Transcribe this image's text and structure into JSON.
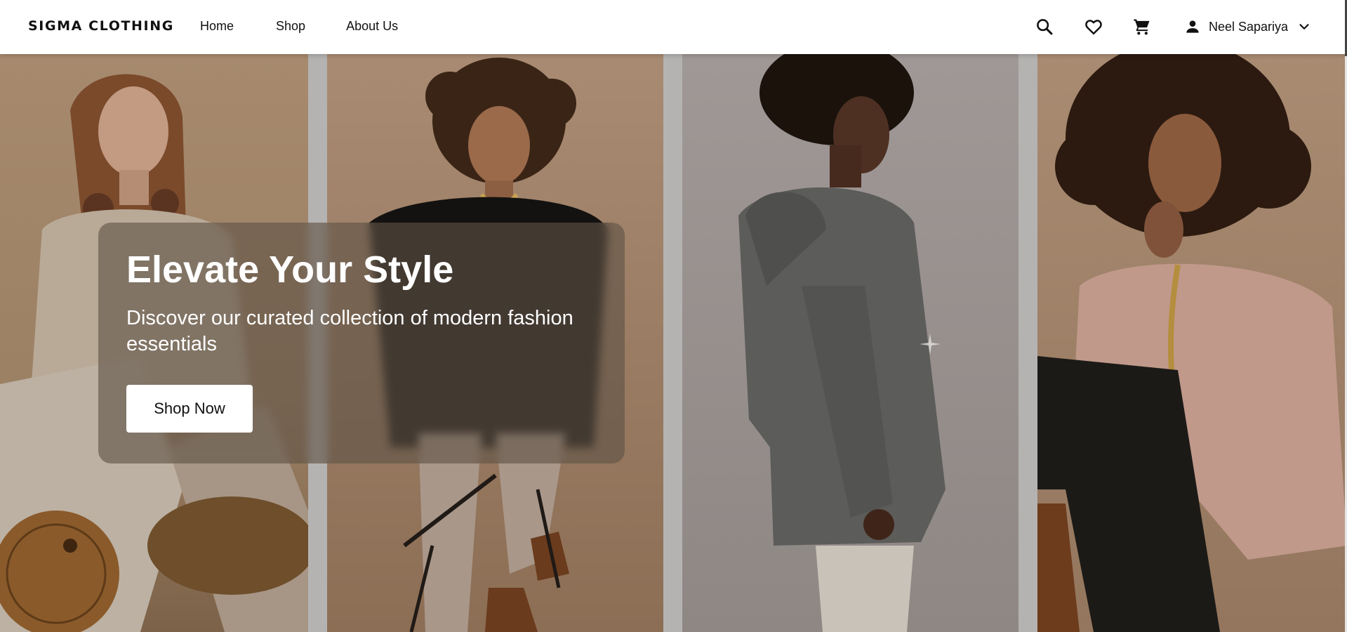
{
  "header": {
    "brand": "SIGMA CLOTHING",
    "nav": [
      {
        "label": "Home"
      },
      {
        "label": "Shop"
      },
      {
        "label": "About Us"
      }
    ],
    "icons": {
      "search": "search-icon",
      "favorites": "heart-icon",
      "cart": "cart-icon",
      "user": "person-icon",
      "dropdown": "chevron-down-icon"
    },
    "user_name": "Neel Sapariya"
  },
  "hero": {
    "title": "Elevate Your Style",
    "subtitle": "Discover our curated collection of modern fashion essentials",
    "cta_label": "Shop Now",
    "images": [
      {
        "name": "model-image-1"
      },
      {
        "name": "model-image-2"
      },
      {
        "name": "model-image-3"
      },
      {
        "name": "model-image-4"
      }
    ]
  },
  "colors": {
    "text_dark": "#111111",
    "header_bg": "#ffffff",
    "hero_bg": "#b5b3b2",
    "card_overlay": "#605246",
    "cta_bg": "#ffffff"
  }
}
